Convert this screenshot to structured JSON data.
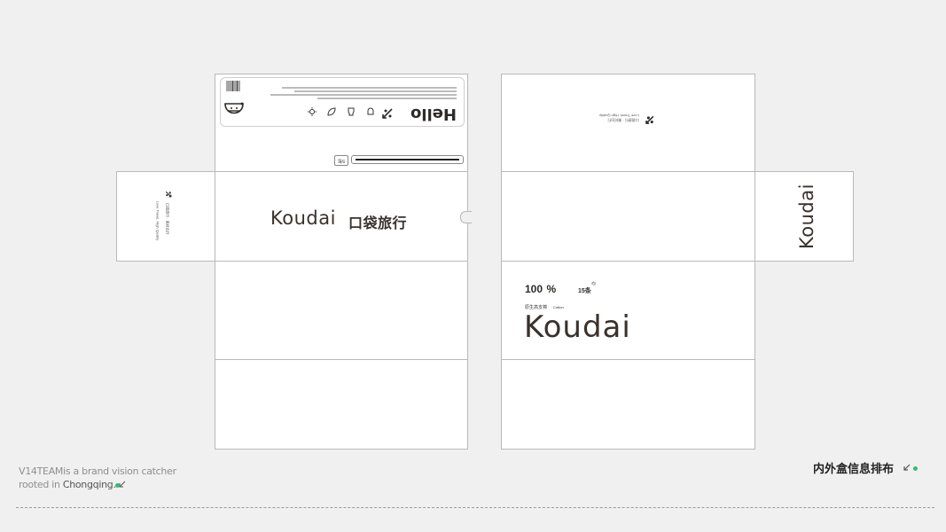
{
  "colors": {
    "background": "#f0f0f0",
    "panel": "#ffffff",
    "brand_text": "#3a312c",
    "accent_dot": "#2fbf71",
    "dashed_line": "#9a9a9a"
  },
  "left_dieline": {
    "logo_en": "Koudai",
    "logo_cn": "口袋旅行",
    "hello": "Hello",
    "size_tag": "5包",
    "side_flap_line1": "口袋旅行 · 美好出行",
    "side_flap_line2": "Love Travel, High Quality"
  },
  "right_dieline": {
    "top_line1": "口袋旅行 · 美好出行",
    "top_line2": "Love Travel, High Quality",
    "side_logo": "Koudai",
    "percent_value": "100",
    "percent_sign": "%",
    "material_cn": "原生高支棉",
    "material_en": "· Cotton",
    "count": "15条",
    "count_unit": "/包",
    "logo_en": "Koudai"
  },
  "footer": {
    "line1_name": "V14TEAM",
    "line1_rest": "is a brand vision catcher",
    "line2_prefix": "rooted in ",
    "line2_city": "Chongqing.",
    "title": "内外盒信息排布"
  },
  "icons": [
    "travel-arrow-icon",
    "cup-icon",
    "bottle-icon",
    "leaf-icon",
    "sun-icon",
    "barcode-icon",
    "mascot-icon",
    "arrow-icon"
  ]
}
